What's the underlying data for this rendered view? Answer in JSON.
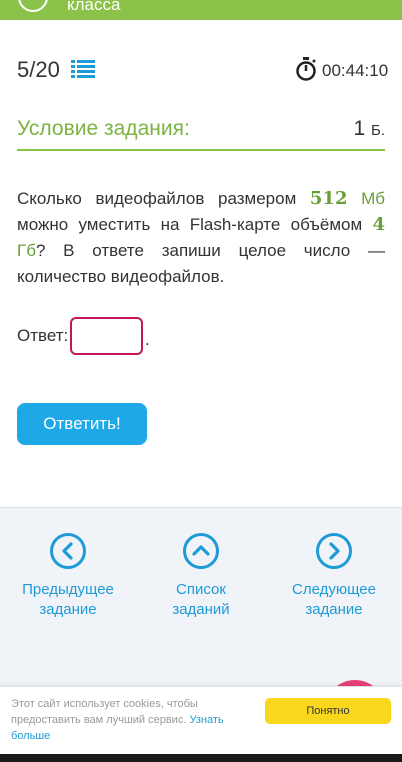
{
  "header": {
    "title": "класса"
  },
  "progress": {
    "current": "5",
    "total": "20",
    "text": "5/20"
  },
  "timer": "00:44:10",
  "condition": {
    "title": "Условие задания:",
    "points_value": "1",
    "points_unit": "Б."
  },
  "question": {
    "part1": "Сколько видеофайлов размером ",
    "num1": "512",
    "unit1": " Мб",
    "part2": " можно уместить на Flash-карте объёмом ",
    "num2": "4",
    "unit2": " Гб",
    "part3": "? В ответе запиши целое число — количество видеофайлов."
  },
  "answer": {
    "label": "Ответ:",
    "value": "",
    "suffix": "."
  },
  "submit_label": "Ответить!",
  "nav": {
    "prev": {
      "line1": "Предыдущее",
      "line2": "задание"
    },
    "list": {
      "line1": "Список",
      "line2": "заданий"
    },
    "next": {
      "line1": "Следующее",
      "line2": "задание"
    }
  },
  "cookie": {
    "text": "Этот сайт использует cookies, чтобы предоставить вам лучший сервис. ",
    "link": "Узнать больше",
    "button": "Понятно"
  },
  "colors": {
    "accent_green": "#8bc34a",
    "link_blue": "#1e9bd7",
    "button_blue": "#1ea8e8",
    "input_border": "#c2185b",
    "cookie_button": "#f9d71c"
  },
  "icons": {
    "back": "back-circle-icon",
    "list": "list-icon",
    "timer": "stopwatch-icon",
    "prev": "chevron-left-circle-icon",
    "up": "chevron-up-circle-icon",
    "next": "chevron-right-circle-icon"
  }
}
